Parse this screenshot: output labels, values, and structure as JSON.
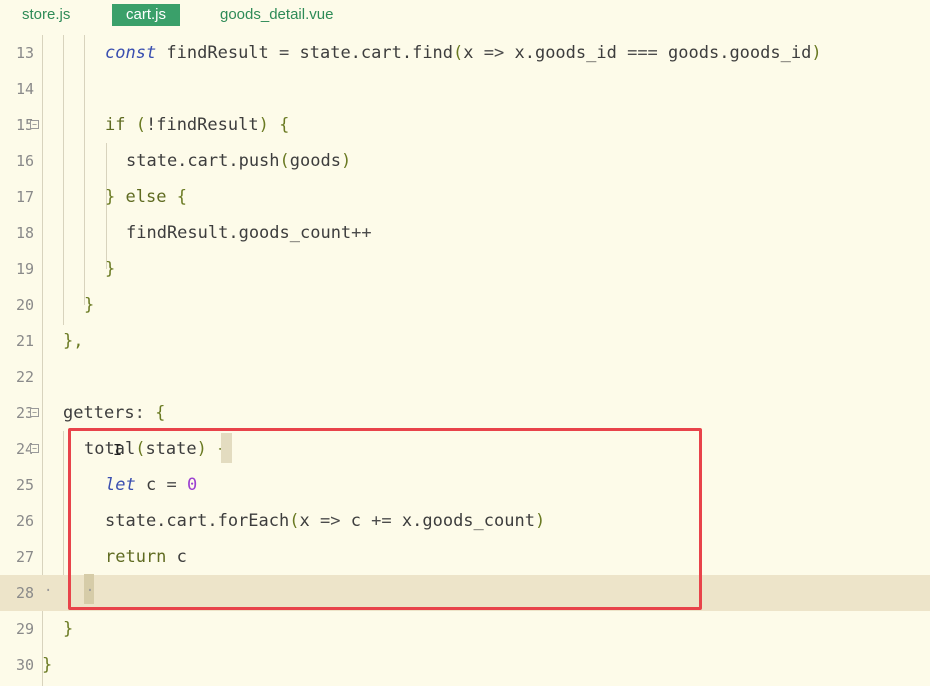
{
  "tabs": [
    {
      "label": "store.js",
      "active": false
    },
    {
      "label": "cart.js",
      "active": true
    },
    {
      "label": "goods_detail.vue",
      "active": false
    }
  ],
  "lines": [
    {
      "no": "13",
      "code": "const findResult = state.cart.find(x => x.goods_id === goods.goods_id)"
    },
    {
      "no": "14",
      "code": ""
    },
    {
      "no": "15",
      "code": "if (!findResult) {"
    },
    {
      "no": "16",
      "code": "state.cart.push(goods)"
    },
    {
      "no": "17",
      "code": "} else {"
    },
    {
      "no": "18",
      "code": "findResult.goods_count++"
    },
    {
      "no": "19",
      "code": "}"
    },
    {
      "no": "20",
      "code": "}"
    },
    {
      "no": "21",
      "code": "},"
    },
    {
      "no": "22",
      "code": ""
    },
    {
      "no": "23",
      "code": "getters: {"
    },
    {
      "no": "24",
      "code": "total(state) {"
    },
    {
      "no": "25",
      "code": "let c = 0"
    },
    {
      "no": "26",
      "code": "state.cart.forEach(x => c += x.goods_count)"
    },
    {
      "no": "27",
      "code": "return c"
    },
    {
      "no": "28",
      "code": "}"
    },
    {
      "no": "29",
      "code": "}"
    },
    {
      "no": "30",
      "code": "}"
    }
  ],
  "colors": {
    "background": "#fdfbe9",
    "active_tab": "#3aa06a",
    "highlight_box": "#e8434a",
    "current_line": "#ede4c9"
  }
}
